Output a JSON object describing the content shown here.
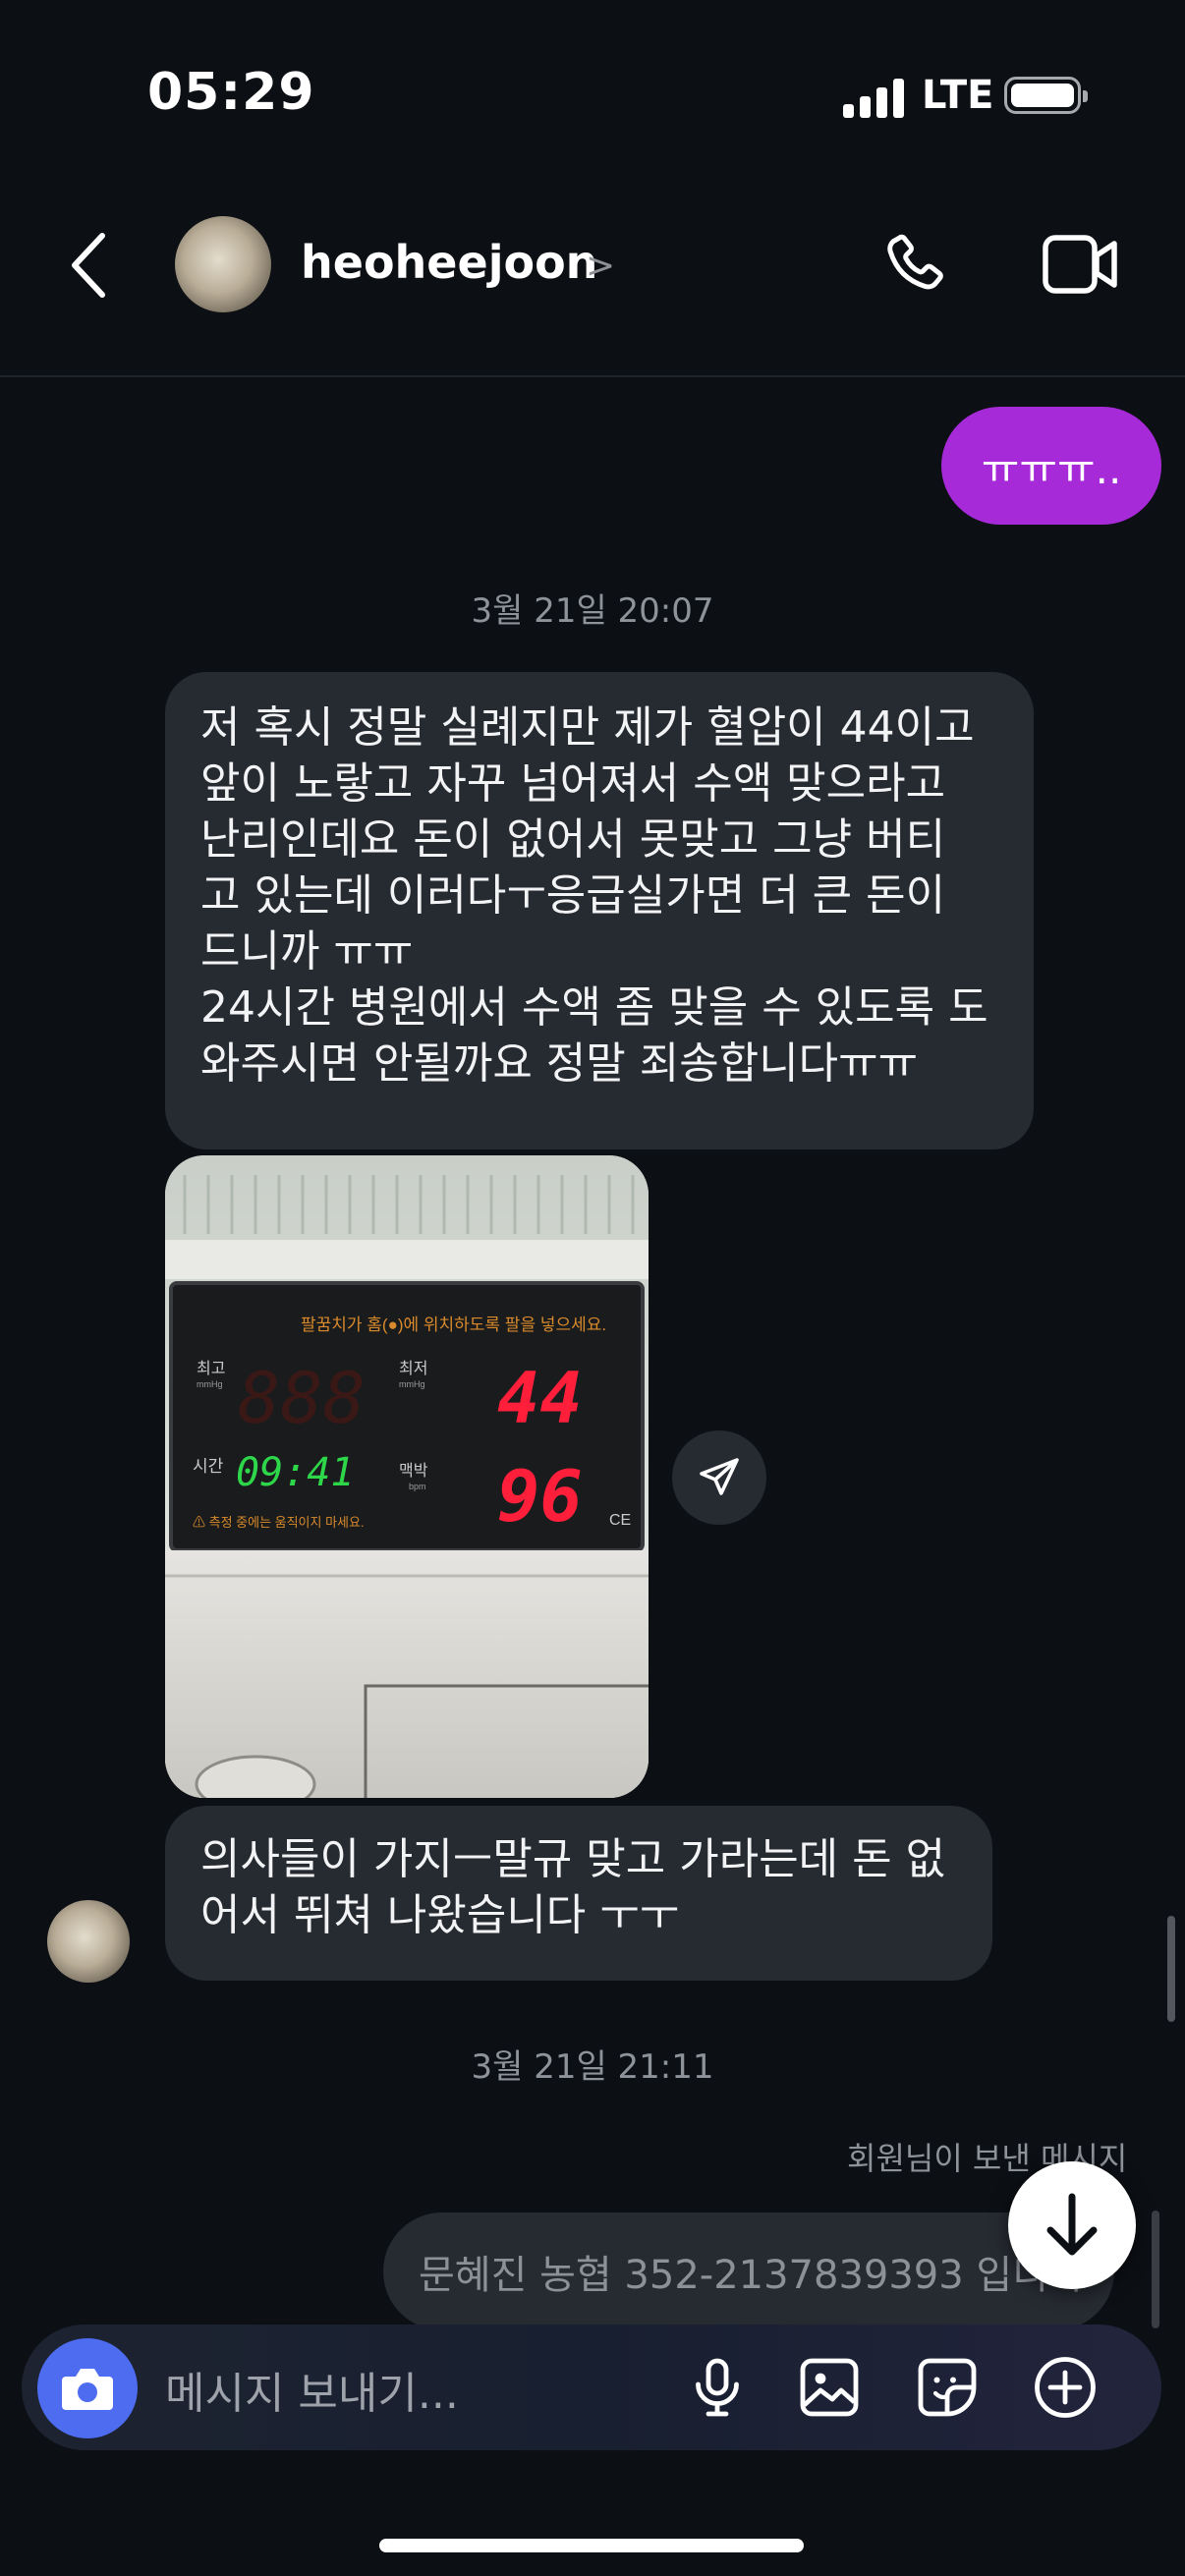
{
  "status_bar": {
    "time": "05:29",
    "network": "LTE"
  },
  "header": {
    "username": "heoheejoon",
    "chevron": ">"
  },
  "messages": {
    "outgoing_1": "ㅠㅠㅠ..",
    "timestamp_1": "3월 21일 20:07",
    "incoming_1": "저 혹시 정말 실례지만 제가 혈압이 44이고\n앞이 노랗고 자꾸 넘어져서 수액 맞으라고\n난리인데요 돈이 없어서 못맞고 그냥 버티\n고 있는데 이러다ㅜ응급실가면 더 큰 돈이\n드니까 ㅠㅠ\n24시간 병원에서 수액 좀 맞을 수 있도록 도\n와주시면 안될까요 정말 죄송합니다ㅠㅠ",
    "photo": {
      "instruction": "팔꿈치가 홈(●)에 위치하도록 팔을 넣으세요.",
      "label_high": "최고",
      "label_low": "최저",
      "label_time": "시간",
      "label_pulse": "맥박",
      "unit_mmhg": "mmHg",
      "unit_bpm": "bpm",
      "high_value": "888",
      "low_value": "44",
      "time_value": "09:41",
      "pulse_value": "96",
      "warning": "⚠ 측정 중에는 움직이지 마세요.",
      "ce_mark": "CE"
    },
    "incoming_2": "의사들이 가지ㅡ말규 맞고 가라는데 돈 없\n어서 뛰쳐 나왔습니다 ㅜㅜ",
    "timestamp_2": "3월 21일 21:11",
    "sent_label": "회원님이 보낸 메시지",
    "outgoing_2": "문혜진 농협 352-2137839393 입니다"
  },
  "composer": {
    "placeholder": "메시지 보내기..."
  },
  "colors": {
    "outgoing_bubble": "#a72ad8",
    "incoming_bubble": "#262a31",
    "camera_button": "#4d6cf0"
  }
}
